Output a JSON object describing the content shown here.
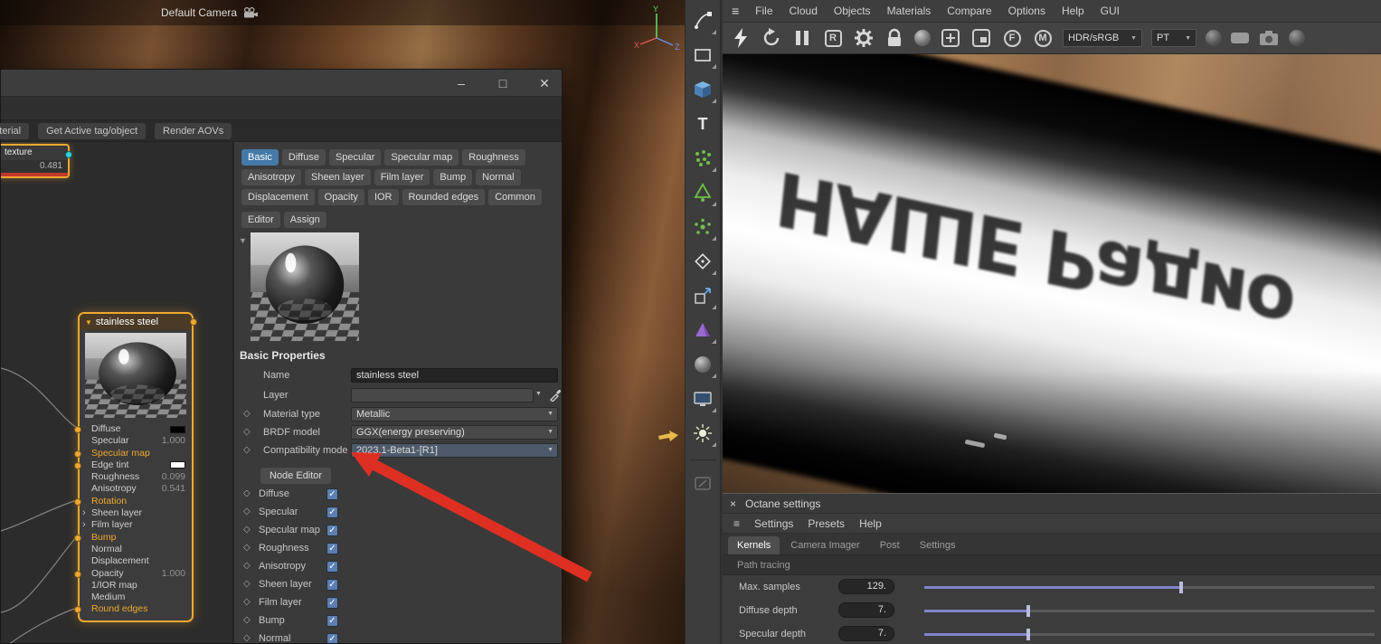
{
  "colors": {
    "accent_orange": "#f0a830",
    "active_tab_blue": "#4579a8",
    "checkbox_blue": "#5c7fb0",
    "slider_purple": "#8084c8",
    "annotation_red": "#dd2f22",
    "axis_y_green": "#5dd65d",
    "axis_z_blue": "#6a8fe8",
    "axis_x_red": "#e05a5a"
  },
  "icons": {
    "caret_down": "▼",
    "diamond": "◇",
    "check": "✓",
    "chevron_right": "›",
    "minimize": "–",
    "maximize": "□",
    "close": "✕",
    "close_small": "×",
    "hamburger": "≡",
    "text_tool": "T",
    "restart": "R",
    "focus_picker": "F",
    "material_picker": "M"
  },
  "viewport": {
    "camera_label": "Default Camera",
    "axis": {
      "x": "X",
      "y": "Y",
      "z": "Z"
    }
  },
  "material_window": {
    "tabs": [
      "material",
      "Get Active tag/object",
      "Render AOVs"
    ],
    "channel_tabs": [
      "Basic",
      "Diffuse",
      "Specular",
      "Specular map",
      "Roughness",
      "Anisotropy",
      "Sheen layer",
      "Film layer",
      "Bump",
      "Normal",
      "Displacement",
      "Opacity",
      "IOR",
      "Rounded edges",
      "Common"
    ],
    "active_channel_tab": "Basic",
    "editor_tabs": [
      "Editor",
      "Assign"
    ],
    "basic_properties": {
      "section_title": "Basic Properties",
      "name": {
        "label": "Name",
        "value": "stainless steel"
      },
      "layer": {
        "label": "Layer",
        "value": ""
      },
      "material_type": {
        "label": "Material type",
        "value": "Metallic"
      },
      "brdf_model": {
        "label": "BRDF model",
        "value": "GGX(energy preserving)"
      },
      "compatibility_mode": {
        "label": "Compatibility mode",
        "value": "2023.1-Beta1-[R1]"
      },
      "node_editor_button": "Node Editor",
      "channel_toggles": [
        {
          "label": "Diffuse",
          "checked": true
        },
        {
          "label": "Specular",
          "checked": true
        },
        {
          "label": "Specular map",
          "checked": true
        },
        {
          "label": "Roughness",
          "checked": true
        },
        {
          "label": "Anisotropy",
          "checked": true
        },
        {
          "label": "Sheen layer",
          "checked": true
        },
        {
          "label": "Film layer",
          "checked": true
        },
        {
          "label": "Bump",
          "checked": true
        },
        {
          "label": "Normal",
          "checked": true
        }
      ]
    }
  },
  "node_graph": {
    "texture_node": {
      "title": "texture",
      "value": "0.481"
    },
    "material_node": {
      "title": "stainless steel",
      "ports": [
        {
          "label": "Diffuse",
          "swatch": "#000000"
        },
        {
          "label": "Specular",
          "value": "1.000"
        },
        {
          "label": "Specular map",
          "accent": true
        },
        {
          "label": "Edge tint",
          "swatch": "#ffffff"
        },
        {
          "label": "Roughness",
          "value": "0.099"
        },
        {
          "label": "Anisotropy",
          "value": "0.541"
        },
        {
          "label": "Rotation",
          "accent": true
        },
        {
          "label": "Sheen layer",
          "expander": true
        },
        {
          "label": "Film layer",
          "expander": true
        },
        {
          "label": "Bump",
          "accent": true
        },
        {
          "label": "Normal"
        },
        {
          "label": "Displacement"
        },
        {
          "label": "Opacity",
          "value": "1.000"
        },
        {
          "label": "1/IOR map"
        },
        {
          "label": "Medium"
        },
        {
          "label": "Round edges",
          "accent": true
        }
      ]
    }
  },
  "side_toolbar": {
    "icons": [
      "spline-pen",
      "rectangle",
      "cube",
      "text",
      "points",
      "generator",
      "scatter",
      "diamond",
      "extrude",
      "volume",
      "sphere",
      "render-view",
      "light",
      "tablet"
    ]
  },
  "main_menu": {
    "items": [
      "File",
      "Cloud",
      "Objects",
      "Materials",
      "Compare",
      "Options",
      "Help",
      "GUI"
    ]
  },
  "render_toolbar": {
    "icons": [
      "start-render",
      "restart-render",
      "pause-render",
      "reset",
      "settings-gear",
      "lock-resolution",
      "render-ball",
      "add-region",
      "sub-region",
      "focus-picker",
      "material-picker"
    ],
    "hdr_mode": "HDR/sRGB",
    "kernel_mode": "PT"
  },
  "render_view": {
    "reflection_text": "НАШЕ Радио"
  },
  "octane_settings": {
    "title": "Octane settings",
    "menus": [
      "Settings",
      "Presets",
      "Help"
    ],
    "tabs": [
      "Kernels",
      "Camera Imager",
      "Post",
      "Settings"
    ],
    "active_tab": "Kernels",
    "section": "Path tracing",
    "parameters": [
      {
        "label": "Max. samples",
        "value": "129.",
        "fraction": 0.57
      },
      {
        "label": "Diffuse depth",
        "value": "7.",
        "fraction": 0.23
      },
      {
        "label": "Specular depth",
        "value": "7.",
        "fraction": 0.23
      }
    ]
  }
}
